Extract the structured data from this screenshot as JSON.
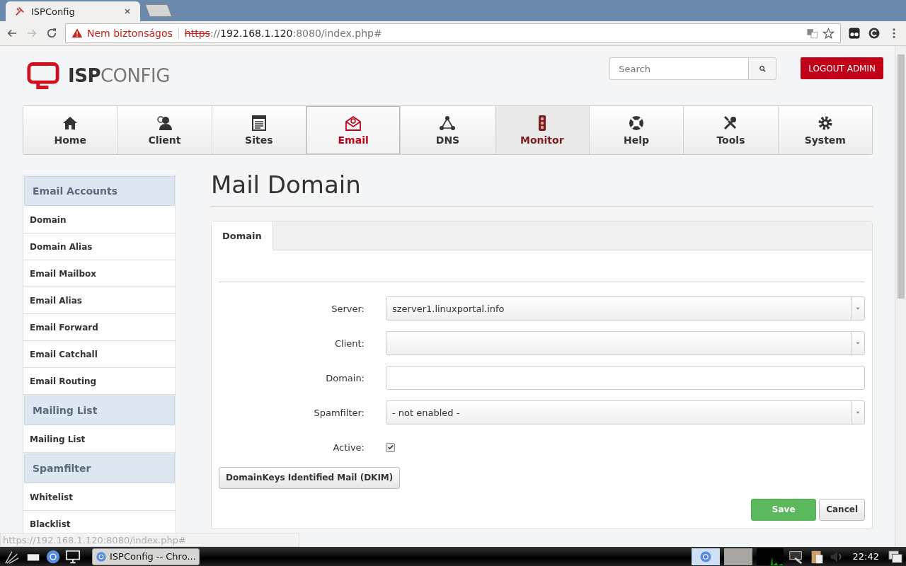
{
  "browser": {
    "tabs": [
      {
        "title": "ISPConfig",
        "selected": true
      }
    ],
    "address": {
      "warning": "Nem biztonságos",
      "scheme": "https",
      "separator": "://",
      "host": "192.168.1.120",
      "rest": ":8080/index.php#"
    },
    "status_url": "https://192.168.1.120:8080/index.php#"
  },
  "header": {
    "logo": [
      "ISP",
      "CONFIG"
    ],
    "search": {
      "placeholder": "Search"
    },
    "logout": "LOGOUT ADMIN"
  },
  "nav": [
    {
      "label": "Home",
      "selected": false,
      "hovered": false
    },
    {
      "label": "Client",
      "selected": false,
      "hovered": false
    },
    {
      "label": "Sites",
      "selected": false,
      "hovered": false
    },
    {
      "label": "Email",
      "selected": true,
      "hovered": false
    },
    {
      "label": "DNS",
      "selected": false,
      "hovered": false
    },
    {
      "label": "Monitor",
      "selected": false,
      "hovered": true
    },
    {
      "label": "Help",
      "selected": false,
      "hovered": false
    },
    {
      "label": "Tools",
      "selected": false,
      "hovered": false
    },
    {
      "label": "System",
      "selected": false,
      "hovered": false
    }
  ],
  "sidebar": [
    {
      "title": "Email Accounts",
      "items": [
        "Domain",
        "Domain Alias",
        "Email Mailbox",
        "Email Alias",
        "Email Forward",
        "Email Catchall",
        "Email Routing"
      ]
    },
    {
      "title": "Mailing List",
      "items": [
        "Mailing List"
      ]
    },
    {
      "title": "Spamfilter",
      "items": [
        "Whitelist",
        "Blacklist"
      ]
    }
  ],
  "main": {
    "title": "Mail Domain",
    "tabs": [
      {
        "label": "Domain",
        "selected": true
      }
    ],
    "fields": [
      {
        "label": "Server:",
        "kind": "select",
        "value": "szerver1.linuxportal.info"
      },
      {
        "label": "Client:",
        "kind": "select"
      },
      {
        "label": "Domain:",
        "kind": "text"
      },
      {
        "label": "Spamfilter:",
        "kind": "select",
        "value": "- not enabled -"
      },
      {
        "label": "Active:",
        "kind": "checkbox",
        "checked": true
      }
    ],
    "dkim_button": "DomainKeys Identified Mail (DKIM)",
    "save": "Save",
    "cancel": "Cancel"
  },
  "taskbar": {
    "window": "ISPConfig -- Chro...",
    "clock": "22:42"
  }
}
